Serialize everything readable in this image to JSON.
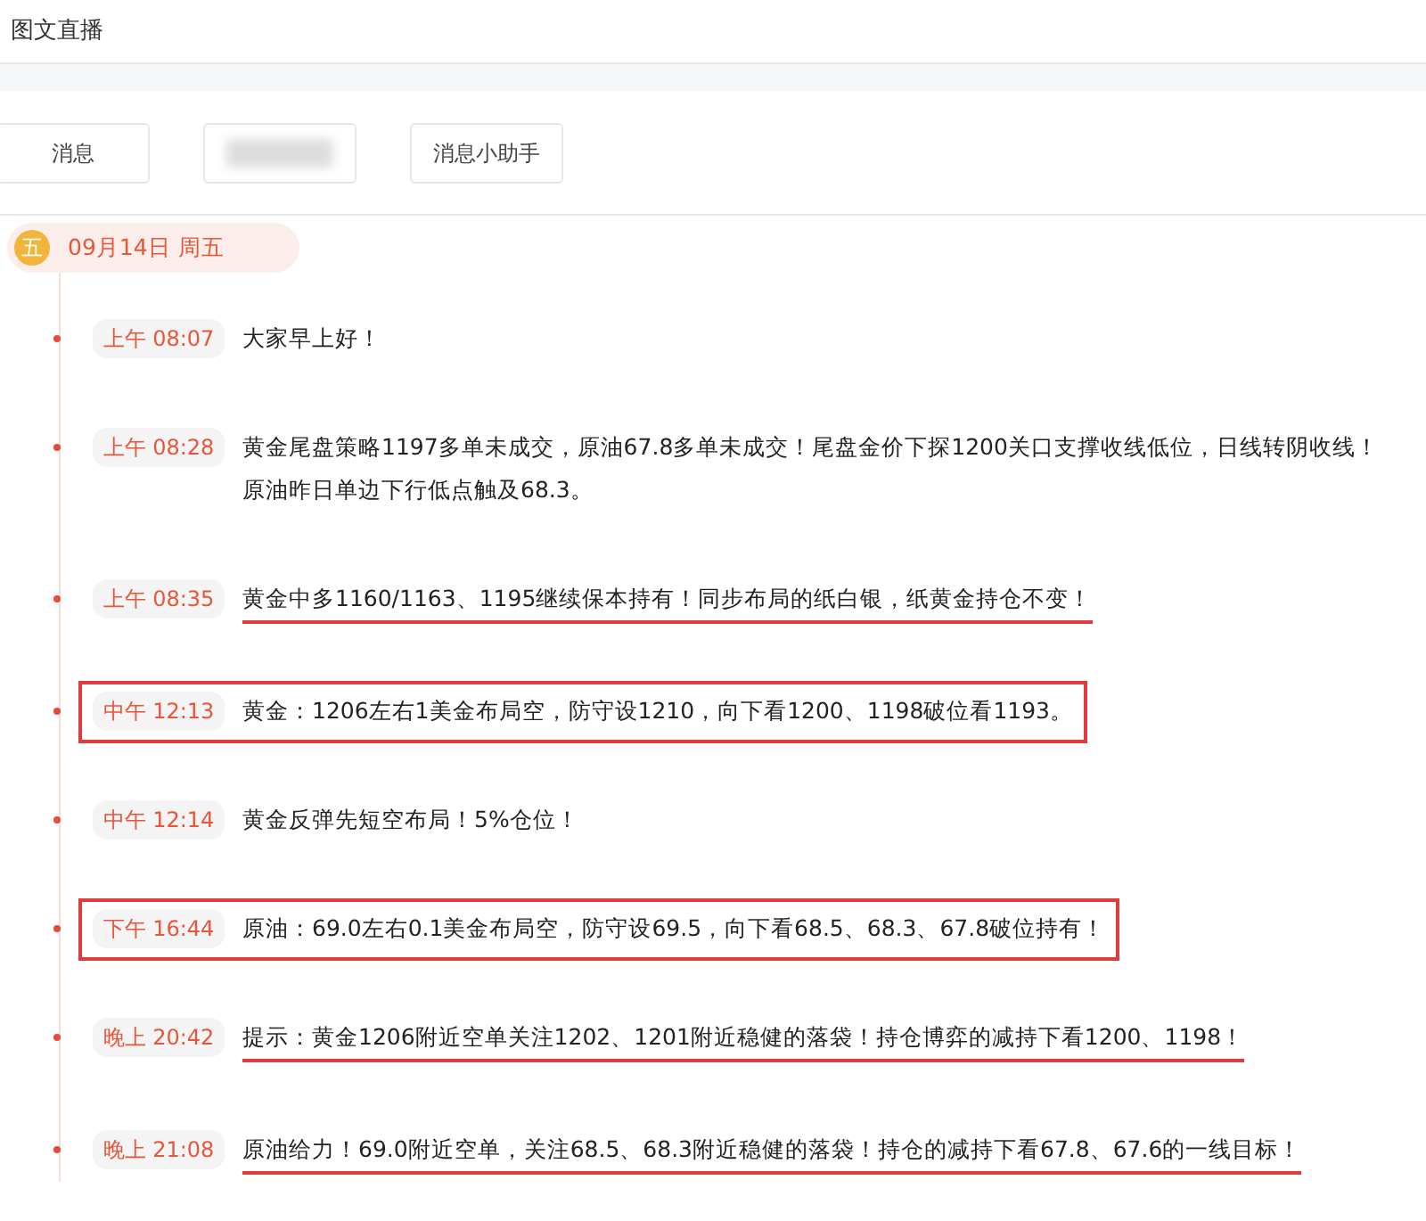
{
  "header": {
    "title": "图文直播"
  },
  "tabs": [
    {
      "label": "消息",
      "kind": "text"
    },
    {
      "kind": "blurred"
    },
    {
      "label": "消息小助手",
      "kind": "text"
    }
  ],
  "date": {
    "weekday_badge": "五",
    "label": "09月14日 周五"
  },
  "messages": [
    {
      "time": "上午 08:07",
      "text": "大家早上好！",
      "kind": "plain"
    },
    {
      "time": "上午 08:28",
      "text": "黄金尾盘策略1197多单未成交，原油67.8多单未成交！尾盘金价下探1200关口支撑收线低位，日线转阴收线！原油昨日单边下行低点触及68.3。",
      "kind": "plain"
    },
    {
      "time": "上午 08:35",
      "text": "黄金中多1160/1163、1195继续保本持有！同步布局的纸白银，纸黄金持仓不变！",
      "kind": "underlined"
    },
    {
      "time": "中午 12:13",
      "text": "黄金：1206左右1美金布局空，防守设1210，向下看1200、1198破位看1193。",
      "kind": "boxed"
    },
    {
      "time": "中午 12:14",
      "text": "黄金反弹先短空布局！5%仓位！",
      "kind": "plain"
    },
    {
      "time": "下午 16:44",
      "text": "原油：69.0左右0.1美金布局空，防守设69.5，向下看68.5、68.3、67.8破位持有！",
      "kind": "boxed"
    },
    {
      "time": "晚上 20:42",
      "text": "提示：黄金1206附近空单关注1202、1201附近稳健的落袋！持仓博弈的减持下看1200、1198！",
      "kind": "underlined"
    },
    {
      "time": "晚上 21:08",
      "text": "原油给力！69.0附近空单，关注68.5、68.3附近稳健的落袋！持仓的减持下看67.8、67.6的一线目标！",
      "kind": "underlined"
    }
  ]
}
